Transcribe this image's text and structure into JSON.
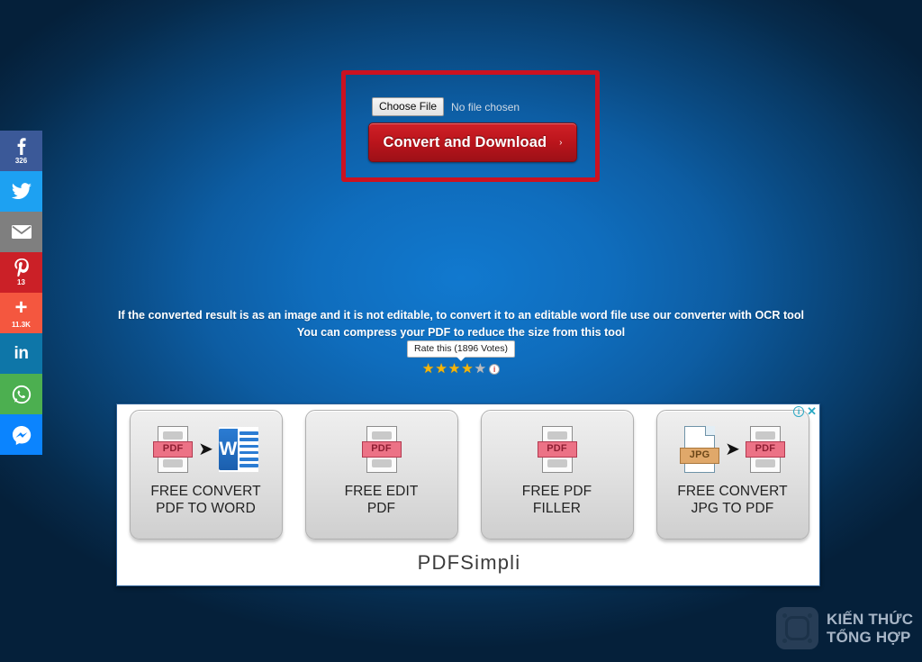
{
  "social_bar": {
    "items": [
      {
        "name": "facebook",
        "glyph": "f",
        "count": "326",
        "color": "#3b5998"
      },
      {
        "name": "twitter",
        "glyph": "t",
        "count": "",
        "color": "#1da1f2"
      },
      {
        "name": "email",
        "glyph": "m",
        "count": "",
        "color": "#7f7f7f"
      },
      {
        "name": "pinterest",
        "glyph": "p",
        "count": "13",
        "color": "#cb2027"
      },
      {
        "name": "share-more",
        "glyph": "+",
        "count": "11.3K",
        "color": "#f4573f"
      },
      {
        "name": "linkedin",
        "glyph": "in",
        "count": "",
        "color": "#0e76a8"
      },
      {
        "name": "whatsapp",
        "glyph": "w",
        "count": "",
        "color": "#4caf50"
      },
      {
        "name": "messenger",
        "glyph": "s",
        "count": "",
        "color": "#0b84fe"
      }
    ]
  },
  "converter": {
    "choose_file_label": "Choose File",
    "file_status": "No file chosen",
    "convert_button_label": "Convert and Download",
    "convert_button_arrow": "›"
  },
  "info": {
    "line1": "If the converted result is as an image and it is not editable, to convert it to an editable word file use our converter with OCR tool",
    "line2": "You can compress your PDF to reduce the size from this tool"
  },
  "rating": {
    "bubble_label": "Rate this (1896 Votes)",
    "stars_filled": 4,
    "stars_total": 5,
    "star_glyph": "★",
    "info_glyph": "i"
  },
  "ad": {
    "brand": "PDFSimpli",
    "adchoices_glyph": "i",
    "close_glyph": "✕",
    "arrow_glyph": "➤",
    "cards": [
      {
        "label_line1": "FREE CONVERT",
        "label_line2": "PDF TO WORD",
        "icon": "pdf-to-word",
        "from_tag": "PDF",
        "to_tag": "W"
      },
      {
        "label_line1": "FREE EDIT",
        "label_line2": "PDF",
        "icon": "pdf",
        "from_tag": "PDF",
        "to_tag": ""
      },
      {
        "label_line1": "FREE PDF",
        "label_line2": "FILLER",
        "icon": "pdf",
        "from_tag": "PDF",
        "to_tag": ""
      },
      {
        "label_line1": "FREE CONVERT",
        "label_line2": "JPG TO PDF",
        "icon": "jpg-to-pdf",
        "from_tag": "JPG",
        "to_tag": "PDF"
      }
    ]
  },
  "watermark": {
    "line1": "KIẾN THỨC",
    "line2": "TỔNG HỢP"
  },
  "colors": {
    "accent_red": "#cc1220",
    "button_red": "#bb151c",
    "background_center_blue": "#1179cf",
    "background_edge_blue": "#05203a",
    "star_gold": "#f5b50a"
  }
}
